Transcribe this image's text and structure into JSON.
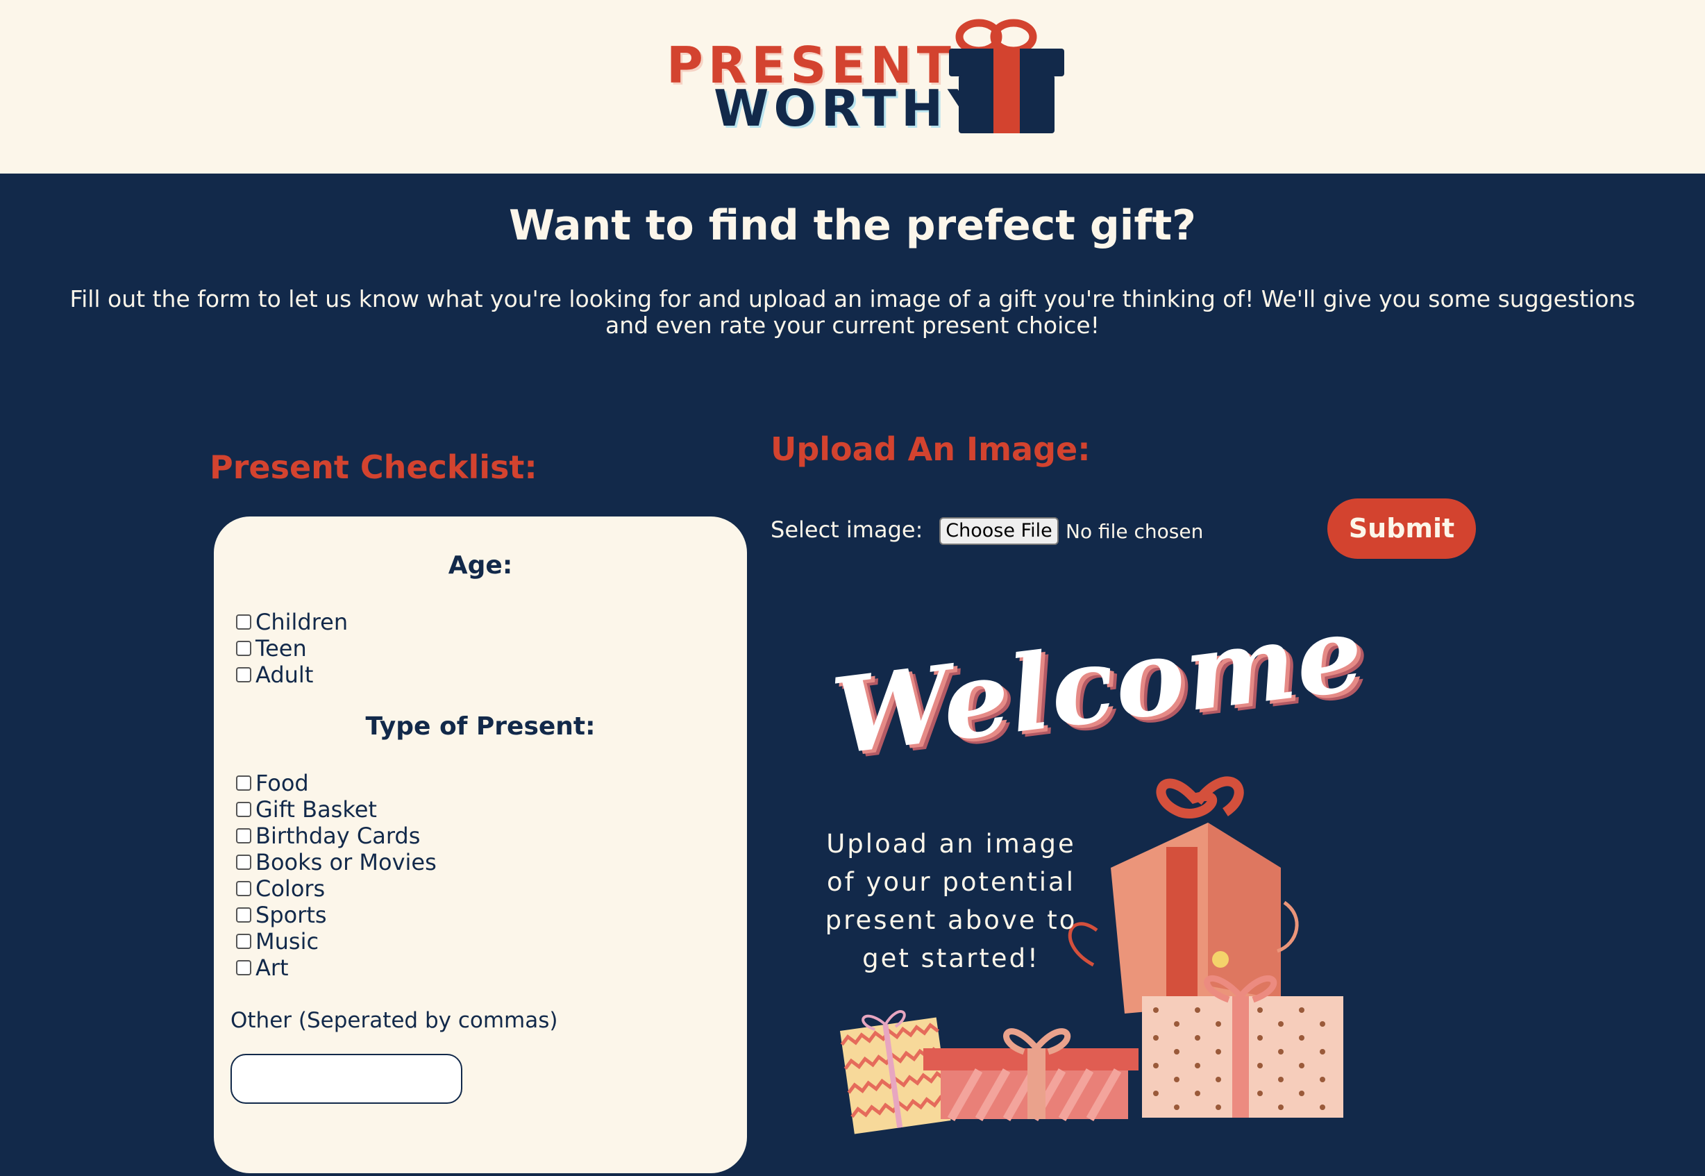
{
  "header": {
    "logo_line1": "PRESENT",
    "logo_line2": "WORTHY"
  },
  "hero": {
    "title": "Want to find the prefect gift?",
    "intro": "Fill out the form to let us know what you're looking for and upload an image of a gift you're thinking of! We'll give you some suggestions and even rate your current present choice!"
  },
  "checklist": {
    "title": "Present Checklist:",
    "age_title": "Age:",
    "age_options": [
      "Children",
      "Teen",
      "Adult"
    ],
    "type_title": "Type of Present:",
    "type_options": [
      "Food",
      "Gift Basket",
      "Birthday Cards",
      "Books or Movies",
      "Colors",
      "Sports",
      "Music",
      "Art"
    ],
    "other_label": "Other (Seperated by commas)",
    "other_value": ""
  },
  "upload": {
    "title": "Upload An Image:",
    "select_label": "Select image:",
    "choose_file_label": "Choose File",
    "file_status": "No file chosen",
    "submit_label": "Submit"
  },
  "welcome": {
    "word": "Welcome",
    "line1": "Upload an image",
    "line2": "of your potential",
    "line3": "present above to",
    "line4": "get started!"
  },
  "colors": {
    "navy": "#12294a",
    "cream": "#fcf6ea",
    "red": "#d3432f"
  },
  "icons": [
    "gift-box-icon",
    "gift-illustration"
  ]
}
